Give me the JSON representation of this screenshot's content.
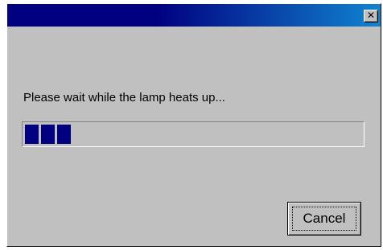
{
  "dialog": {
    "title": "",
    "close_glyph": "✕",
    "message": "Please wait while the lamp heats up...",
    "progress": {
      "filled_blocks": 3,
      "fraction": 0.14
    },
    "cancel_label": "Cancel"
  },
  "colors": {
    "titlebar_start": "#000080",
    "titlebar_end": "#1084d0",
    "progress_fill": "#000080",
    "dialog_background": "#c0c0c0"
  }
}
